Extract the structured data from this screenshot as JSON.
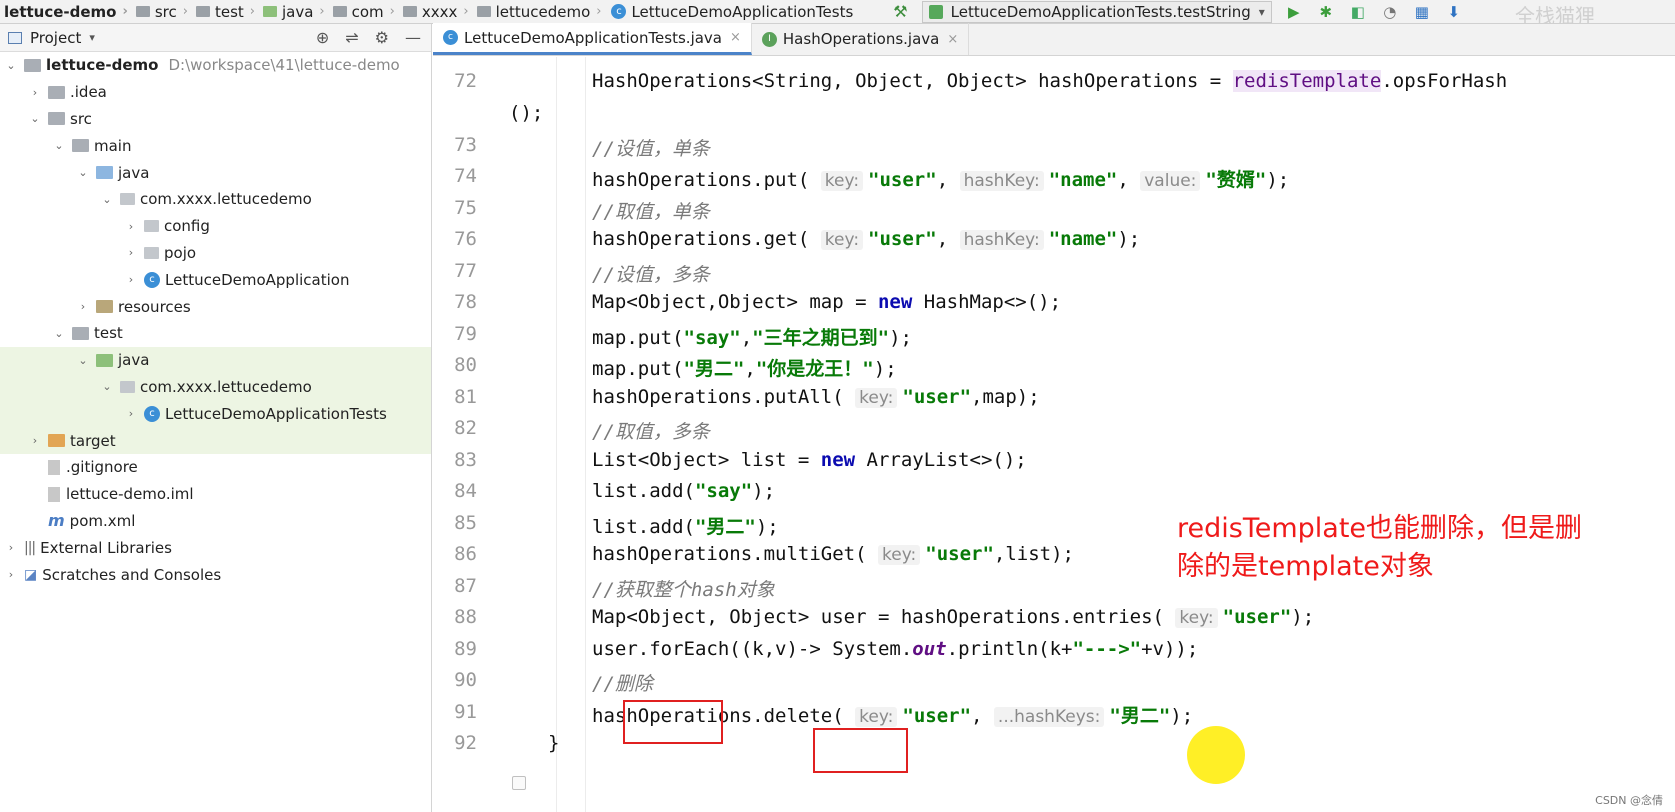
{
  "breadcrumb": [
    "lettuce-demo",
    "src",
    "test",
    "java",
    "com",
    "xxxx",
    "lettucedemo",
    "LettuceDemoApplicationTests"
  ],
  "run_config": "LettuceDemoApplicationTests.testString",
  "watermark": "全栈猫狸",
  "project_panel": {
    "title": "Project",
    "tree": [
      {
        "label": "lettuce-demo",
        "path": "D:\\workspace\\41\\lettuce-demo",
        "depth": 0,
        "arrow": "down",
        "icon": "module-folder",
        "bold": true
      },
      {
        "label": ".idea",
        "depth": 1,
        "arrow": "right",
        "icon": "folder"
      },
      {
        "label": "src",
        "depth": 1,
        "arrow": "down",
        "icon": "folder"
      },
      {
        "label": "main",
        "depth": 2,
        "arrow": "down",
        "icon": "folder"
      },
      {
        "label": "java",
        "depth": 3,
        "arrow": "down",
        "icon": "source-folder"
      },
      {
        "label": "com.xxxx.lettucedemo",
        "depth": 4,
        "arrow": "down",
        "icon": "package"
      },
      {
        "label": "config",
        "depth": 5,
        "arrow": "right",
        "icon": "package"
      },
      {
        "label": "pojo",
        "depth": 5,
        "arrow": "right",
        "icon": "package"
      },
      {
        "label": "LettuceDemoApplication",
        "depth": 5,
        "arrow": "right",
        "icon": "class"
      },
      {
        "label": "resources",
        "depth": 3,
        "arrow": "right",
        "icon": "resources-folder"
      },
      {
        "label": "test",
        "depth": 2,
        "arrow": "down",
        "icon": "folder"
      },
      {
        "label": "java",
        "depth": 3,
        "arrow": "down",
        "icon": "test-folder",
        "highlight": true
      },
      {
        "label": "com.xxxx.lettucedemo",
        "depth": 4,
        "arrow": "down",
        "icon": "package",
        "highlight": true
      },
      {
        "label": "LettuceDemoApplicationTests",
        "depth": 5,
        "arrow": "right",
        "icon": "class",
        "highlight": true
      },
      {
        "label": "target",
        "depth": 1,
        "arrow": "right",
        "icon": "excluded-folder",
        "highlight": true
      },
      {
        "label": ".gitignore",
        "depth": 1,
        "arrow": "none",
        "icon": "file"
      },
      {
        "label": "lettuce-demo.iml",
        "depth": 1,
        "arrow": "none",
        "icon": "file"
      },
      {
        "label": "pom.xml",
        "depth": 1,
        "arrow": "none",
        "icon": "maven"
      },
      {
        "label": "External Libraries",
        "depth": 0,
        "arrow": "right",
        "icon": "library"
      },
      {
        "label": "Scratches and Consoles",
        "depth": 0,
        "arrow": "right",
        "icon": "scratch"
      }
    ]
  },
  "tabs": [
    {
      "label": "LettuceDemoApplicationTests.java",
      "icon": "class",
      "active": true
    },
    {
      "label": "HashOperations.java",
      "icon": "interface",
      "active": false
    }
  ],
  "line_numbers": [
    "72",
    "73",
    "74",
    "75",
    "76",
    "77",
    "78",
    "79",
    "80",
    "81",
    "82",
    "83",
    "84",
    "85",
    "86",
    "87",
    "88",
    "89",
    "90",
    "91",
    "92"
  ],
  "code": {
    "l72a_pre": "HashOperations<String, Object, Object> hashOperations = ",
    "l72a_field": "redisTemplate",
    "l72a_post": ".opsForHash",
    "l72b": "();",
    "l73": "//设值，单条",
    "l74_pre": "hashOperations.put(",
    "l74_h1": "key:",
    "l74_s1": "\"user\"",
    "l74_c1": ", ",
    "l74_h2": "hashKey:",
    "l74_s2": "\"name\"",
    "l74_c2": ", ",
    "l74_h3": "value:",
    "l74_s3": "\"赘婿\"",
    "l74_end": ");",
    "l75": "//取值，单条",
    "l76_pre": "hashOperations.get(",
    "l76_h1": "key:",
    "l76_s1": "\"user\"",
    "l76_c1": ", ",
    "l76_h2": "hashKey:",
    "l76_s2": "\"name\"",
    "l76_end": ");",
    "l77": "//设值，多条",
    "l78_pre": "Map<Object,Object> map = ",
    "l78_kw": "new",
    "l78_post": " HashMap<>();",
    "l79_pre": "map.put(",
    "l79_s1": "\"say\"",
    "l79_c": ",",
    "l79_s2": "\"三年之期已到\"",
    "l79_end": ");",
    "l80_pre": "map.put(",
    "l80_s1": "\"男二\"",
    "l80_c": ",",
    "l80_s2": "\"你是龙王！\"",
    "l80_end": ");",
    "l81_pre": "hashOperations.putAll(",
    "l81_h1": "key:",
    "l81_s1": "\"user\"",
    "l81_end": ",map);",
    "l82": "//取值，多条",
    "l83_pre": "List<Object> list = ",
    "l83_kw": "new",
    "l83_post": " ArrayList<>();",
    "l84_pre": "list.add(",
    "l84_s": "\"say\"",
    "l84_end": ");",
    "l85_pre": "list.add(",
    "l85_s": "\"男二\"",
    "l85_end": ");",
    "l86_pre": "hashOperations.multiGet(",
    "l86_h1": "key:",
    "l86_s1": "\"user\"",
    "l86_end": ",list);",
    "l87": "//获取整个hash对象",
    "l88_pre": "Map<Object, Object> user = hashOperations.entries(",
    "l88_h1": "key:",
    "l88_s1": "\"user\"",
    "l88_end": ");",
    "l89_pre": "user.forEach((k,v)-> System.",
    "l89_field": "out",
    "l89_mid": ".println(k+",
    "l89_s": "\"--->\"",
    "l89_end": "+v));",
    "l90": "//删除",
    "l91_pre": "hashOperations",
    "l91_del": ".delete",
    "l91_paren": "(",
    "l91_h1": "key:",
    "l91_s1": "\"user\"",
    "l91_c": ", ",
    "l91_h2": "...hashKeys:",
    "l91_s2": "\"男二\"",
    "l91_end": ");",
    "l92": "}"
  },
  "annotation": {
    "line1": "redisTemplate也能删除，但是删",
    "line2": "除的是template对象",
    "color": "#ef1a1a"
  },
  "footer_watermark": "CSDN @念倩"
}
